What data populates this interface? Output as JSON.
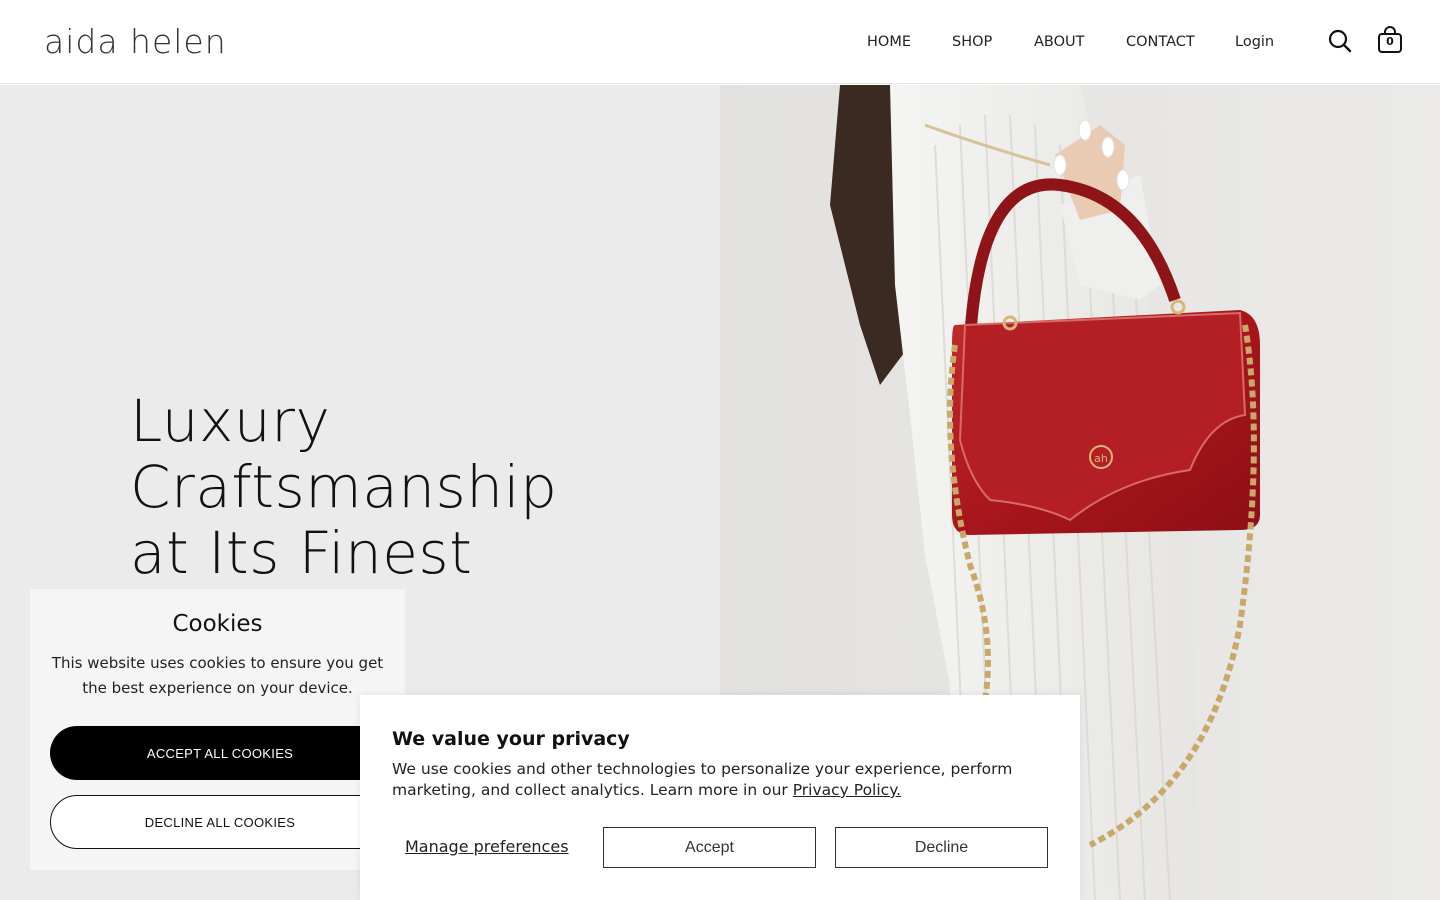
{
  "header": {
    "logo": "aida helen",
    "nav": [
      {
        "label": "HOME"
      },
      {
        "label": "SHOP"
      },
      {
        "label": "ABOUT"
      },
      {
        "label": "CONTACT"
      },
      {
        "label": "Login"
      }
    ],
    "cart_count": "0",
    "icons": [
      "search-icon",
      "shopping-bag-icon"
    ]
  },
  "hero": {
    "title_lines": [
      "Luxury",
      "Craftsmanship",
      "at Its Finest"
    ],
    "image_alt": "Woman holding red patent leather handbag with gold chain",
    "colors": {
      "left_bg": "#ebebec",
      "bag": "#b01d22",
      "chain": "#c9a86a"
    }
  },
  "cookie_panel": {
    "title": "Cookies",
    "text": "This website uses cookies to ensure you get the best experience on your device.",
    "accept_label": "ACCEPT ALL COOKIES",
    "decline_label": "DECLINE ALL COOKIES"
  },
  "privacy_dialog": {
    "title": "We value your privacy",
    "text": "We use cookies and other technologies to personalize your experience, perform marketing, and collect analytics. Learn more in our",
    "link": "Privacy Policy.",
    "manage_label": "Manage preferences",
    "accept_label": "Accept",
    "decline_label": "Decline"
  }
}
